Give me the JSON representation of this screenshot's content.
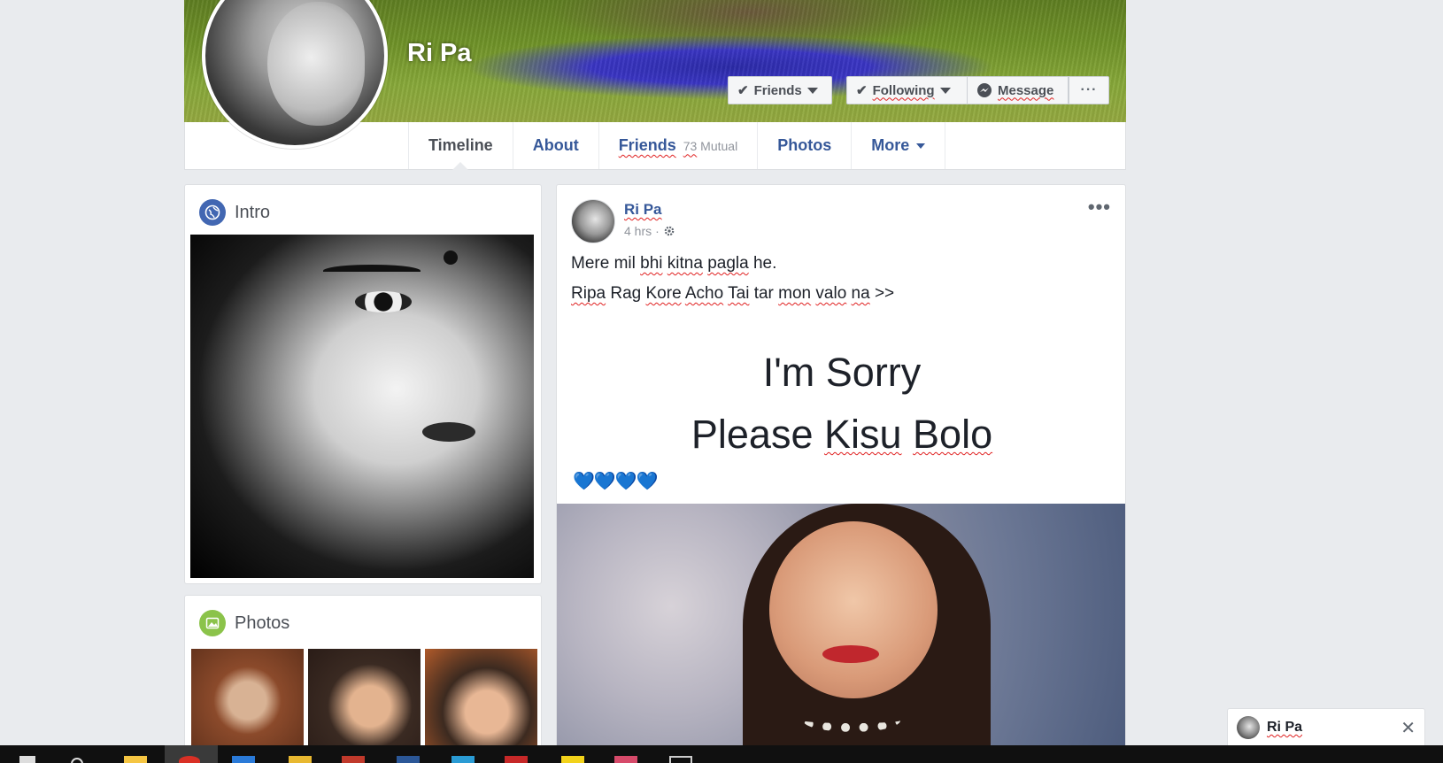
{
  "profile": {
    "name": "Ri Pa",
    "buttons": {
      "friends": "Friends",
      "following": "Following",
      "message": "Message",
      "more": "···"
    }
  },
  "nav": {
    "tabs": [
      {
        "label": "Timeline"
      },
      {
        "label": "About"
      },
      {
        "label": "Friends",
        "mutual_count": "73",
        "mutual_label": "Mutual"
      },
      {
        "label": "Photos"
      },
      {
        "label": "More"
      }
    ]
  },
  "intro": {
    "title": "Intro"
  },
  "photos": {
    "title": "Photos"
  },
  "post": {
    "author": "Ri Pa",
    "time": "4 hrs",
    "separator": "·",
    "menu": "•••",
    "line1": [
      "Mere mil ",
      "bhi",
      " ",
      "kitna",
      " ",
      "pagla",
      " he."
    ],
    "line2": [
      "Ripa",
      " Rag ",
      "Kore",
      " ",
      "Acho",
      " ",
      "Tai",
      " tar ",
      "mon",
      " ",
      "valo",
      " ",
      "na",
      " >>"
    ],
    "big1": "I'm Sorry",
    "big2": [
      "Please ",
      "Kisu",
      " ",
      "Bolo"
    ],
    "hearts": "💙💙💙💙"
  },
  "chat": {
    "name": "Ri Pa",
    "close": "✕"
  },
  "colors": {
    "fb_blue": "#365899",
    "brand": "#4267b2",
    "bg": "#e9ebee"
  }
}
